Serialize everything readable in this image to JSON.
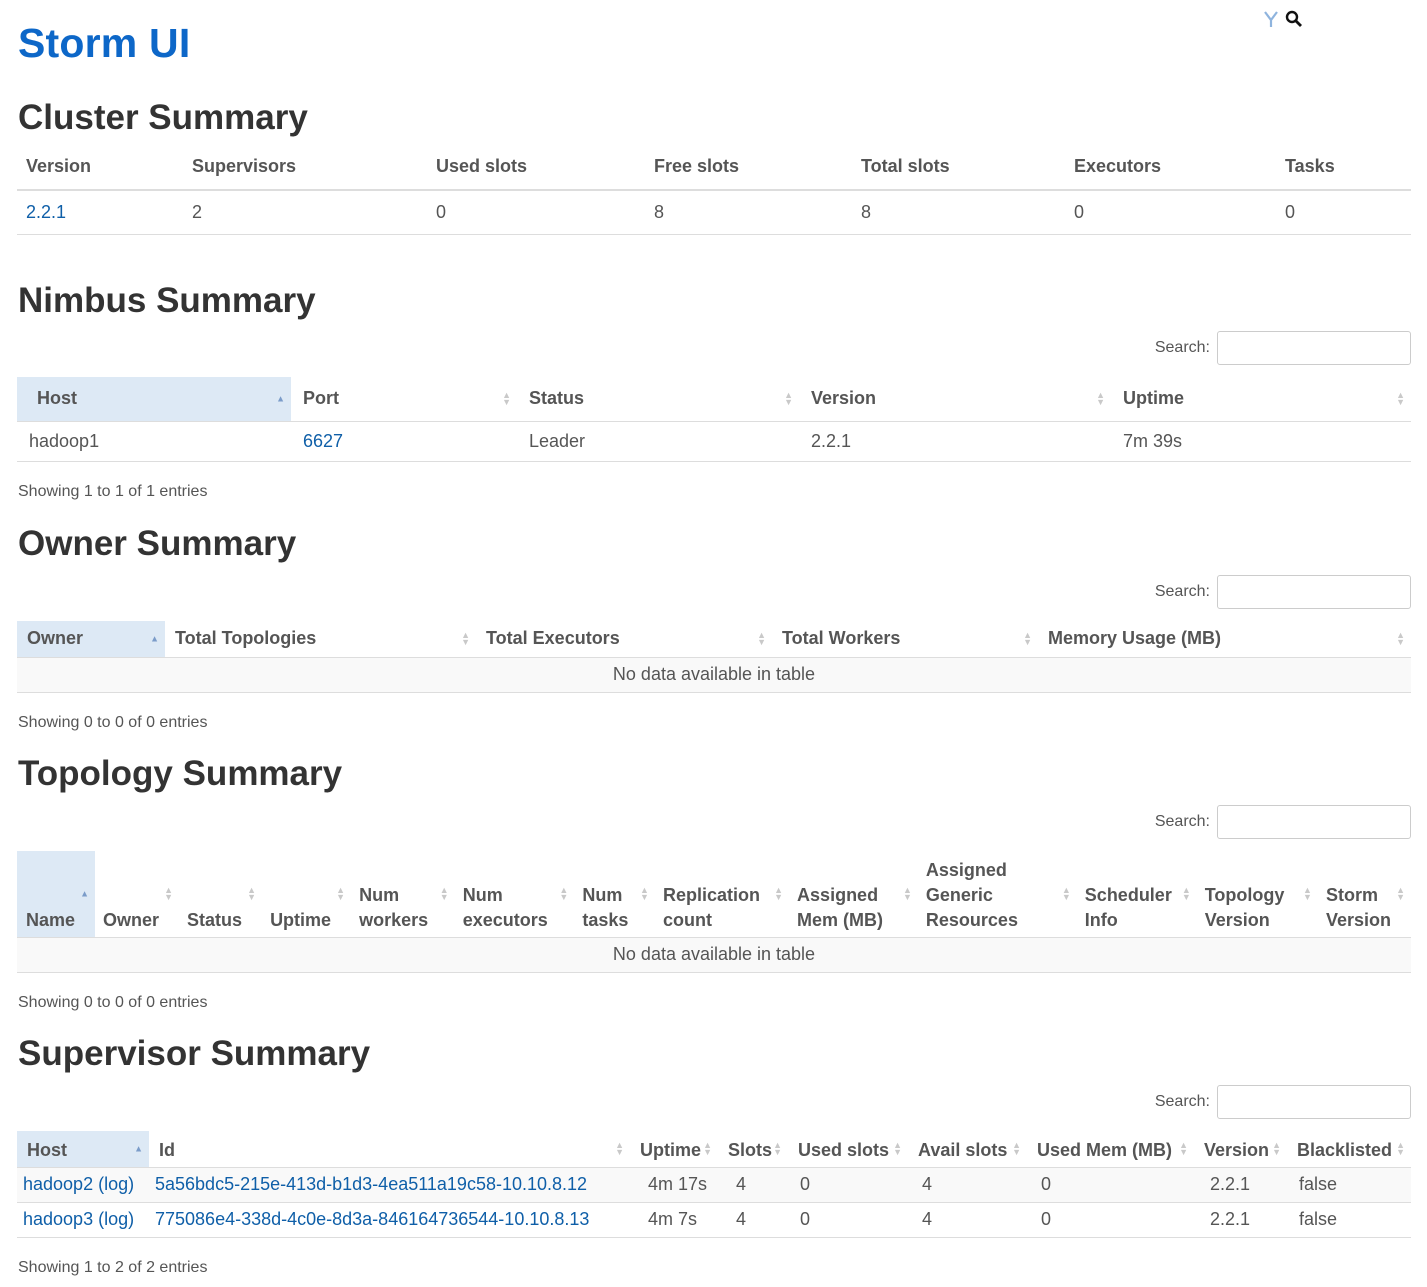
{
  "app": {
    "title": "Storm UI"
  },
  "top_icons": [
    "yarn-icon",
    "search-icon"
  ],
  "cluster": {
    "heading": "Cluster Summary",
    "columns": [
      "Version",
      "Supervisors",
      "Used slots",
      "Free slots",
      "Total slots",
      "Executors",
      "Tasks"
    ],
    "row": [
      "2.2.1",
      "2",
      "0",
      "8",
      "8",
      "0",
      "0"
    ]
  },
  "nimbus": {
    "heading": "Nimbus Summary",
    "search_label": "Search:",
    "columns": [
      "Host",
      "Port",
      "Status",
      "Version",
      "Uptime"
    ],
    "rows": [
      [
        "hadoop1",
        "6627",
        "Leader",
        "2.2.1",
        "7m 39s"
      ]
    ],
    "info": "Showing 1 to 1 of 1 entries"
  },
  "owner": {
    "heading": "Owner Summary",
    "search_label": "Search:",
    "columns": [
      "Owner",
      "Total Topologies",
      "Total Executors",
      "Total Workers",
      "Memory Usage (MB)"
    ],
    "empty": "No data available in table",
    "info": "Showing 0 to 0 of 0 entries"
  },
  "topology": {
    "heading": "Topology Summary",
    "search_label": "Search:",
    "columns": [
      [
        "Name"
      ],
      [
        "Owner"
      ],
      [
        "Status"
      ],
      [
        "Uptime"
      ],
      [
        "Num",
        "workers"
      ],
      [
        "Num",
        "executors"
      ],
      [
        "Num",
        "tasks"
      ],
      [
        "Replication",
        "count"
      ],
      [
        "Assigned",
        "Mem (MB)"
      ],
      [
        "Assigned",
        "Generic",
        "Resources"
      ],
      [
        "Scheduler",
        "Info"
      ],
      [
        "Topology",
        "Version"
      ],
      [
        "Storm",
        "Version"
      ]
    ],
    "empty": "No data available in table",
    "info": "Showing 0 to 0 of 0 entries"
  },
  "supervisor": {
    "heading": "Supervisor Summary",
    "search_label": "Search:",
    "columns": [
      "Host",
      "Id",
      "Uptime",
      "Slots",
      "Used slots",
      "Avail slots",
      "Used Mem (MB)",
      "Version",
      "Blacklisted"
    ],
    "rows": [
      {
        "host": "hadoop2",
        "log": "(log)",
        "id": "5a56bdc5-215e-413d-b1d3-4ea511a19c58-10.10.8.12",
        "uptime": "4m 17s",
        "slots": "4",
        "used_slots": "0",
        "avail_slots": "4",
        "used_mem": "0",
        "version": "2.2.1",
        "blacklisted": "false"
      },
      {
        "host": "hadoop3",
        "log": "(log)",
        "id": "775086e4-338d-4c0e-8d3a-846164736544-10.10.8.13",
        "uptime": "4m 7s",
        "slots": "4",
        "used_slots": "0",
        "avail_slots": "4",
        "used_mem": "0",
        "version": "2.2.1",
        "blacklisted": "false"
      }
    ],
    "info": "Showing 1 to 2 of 2 entries"
  },
  "colors": {
    "title": "#0d67c8",
    "link": "#0f5fa8",
    "sorted_header": "#dde9f5"
  }
}
